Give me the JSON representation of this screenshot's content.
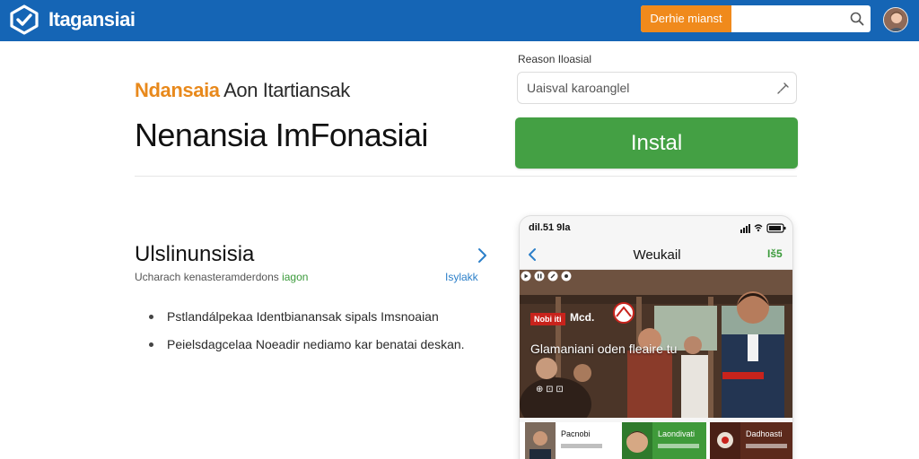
{
  "topbar": {
    "brand": "Itagansiai",
    "search_button": "Derhie mianst",
    "search_placeholder": "",
    "colors": {
      "bar": "#1565b5",
      "accent": "#f08a1c"
    }
  },
  "hero": {
    "subtitle_accent": "Ndansaia",
    "subtitle_rest": " Aon Itartiansak",
    "title": "Nenansia ImFonasiai"
  },
  "form": {
    "label": "Reason Iloasial",
    "input_value": "Uaisval karoanglel",
    "install_label": "Instal",
    "install_color": "#44a044"
  },
  "section": {
    "title": "Ulslinunsisia",
    "subtitle_main": "Ucharach kenasteramderdons ",
    "subtitle_green": "iagon",
    "link": "Isylakk",
    "bullets": [
      "Pstlandálpekaa Identbianansak sipals Imsnoaian",
      "Peielsdagcelaa Noeadir nediamo kar benatai deskan."
    ]
  },
  "phone": {
    "status_time": "dil.51 9la",
    "app_title": "Weukail",
    "header_action": "Iš5",
    "badge": "Nobi iti",
    "badge2": "Mcd.",
    "caption": "Glamaniani oden fleaire tu",
    "meta": "⊕ ⊡ ⊡",
    "thumbs": [
      {
        "label": "Pacnobi"
      },
      {
        "label": "Laondivati"
      },
      {
        "label": "Dadhoasti"
      }
    ]
  }
}
